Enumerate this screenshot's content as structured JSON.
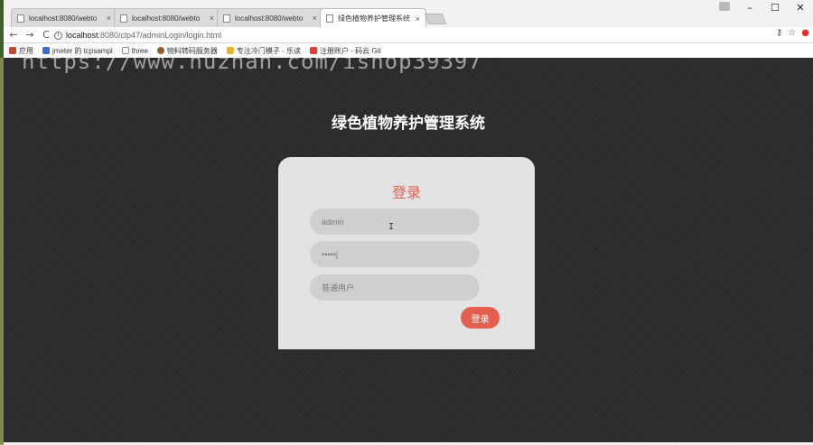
{
  "browser": {
    "tabs": [
      {
        "title": "localhost:8080/webto"
      },
      {
        "title": "localhost:8080/webto"
      },
      {
        "title": "localhost:8080/webto"
      },
      {
        "title": "绿色植物养护管理系统"
      }
    ],
    "tab_close": "×",
    "window_controls": {
      "minimize": "–",
      "maximize": "☐",
      "close": "✕"
    },
    "nav": {
      "back": "←",
      "forward": "→",
      "reload": "C"
    },
    "url": {
      "host": "localhost",
      "path": ":8080/clp47/adminLogin/login.html"
    },
    "bookmarks": [
      {
        "label": "应用"
      },
      {
        "label": "jmeter 的 tcpsampl"
      },
      {
        "label": "three"
      },
      {
        "label": "物料转码服务器"
      },
      {
        "label": "专注冷门模子 - 乐读"
      },
      {
        "label": "注册账户 - 码云 Git"
      }
    ]
  },
  "watermark": "https://www.huzhan.com/ishop39397",
  "page": {
    "site_title": "绿色植物养护管理系统",
    "login": {
      "heading": "登录",
      "username_placeholder": "admin",
      "password_value": "•••••|",
      "role_placeholder": "普通用户",
      "submit_label": "登录"
    }
  },
  "colors": {
    "accent": "#e2604f",
    "page_bg": "#2c2c2e",
    "card_bg": "#e3e3e3",
    "field_bg": "#cfcfcf"
  }
}
